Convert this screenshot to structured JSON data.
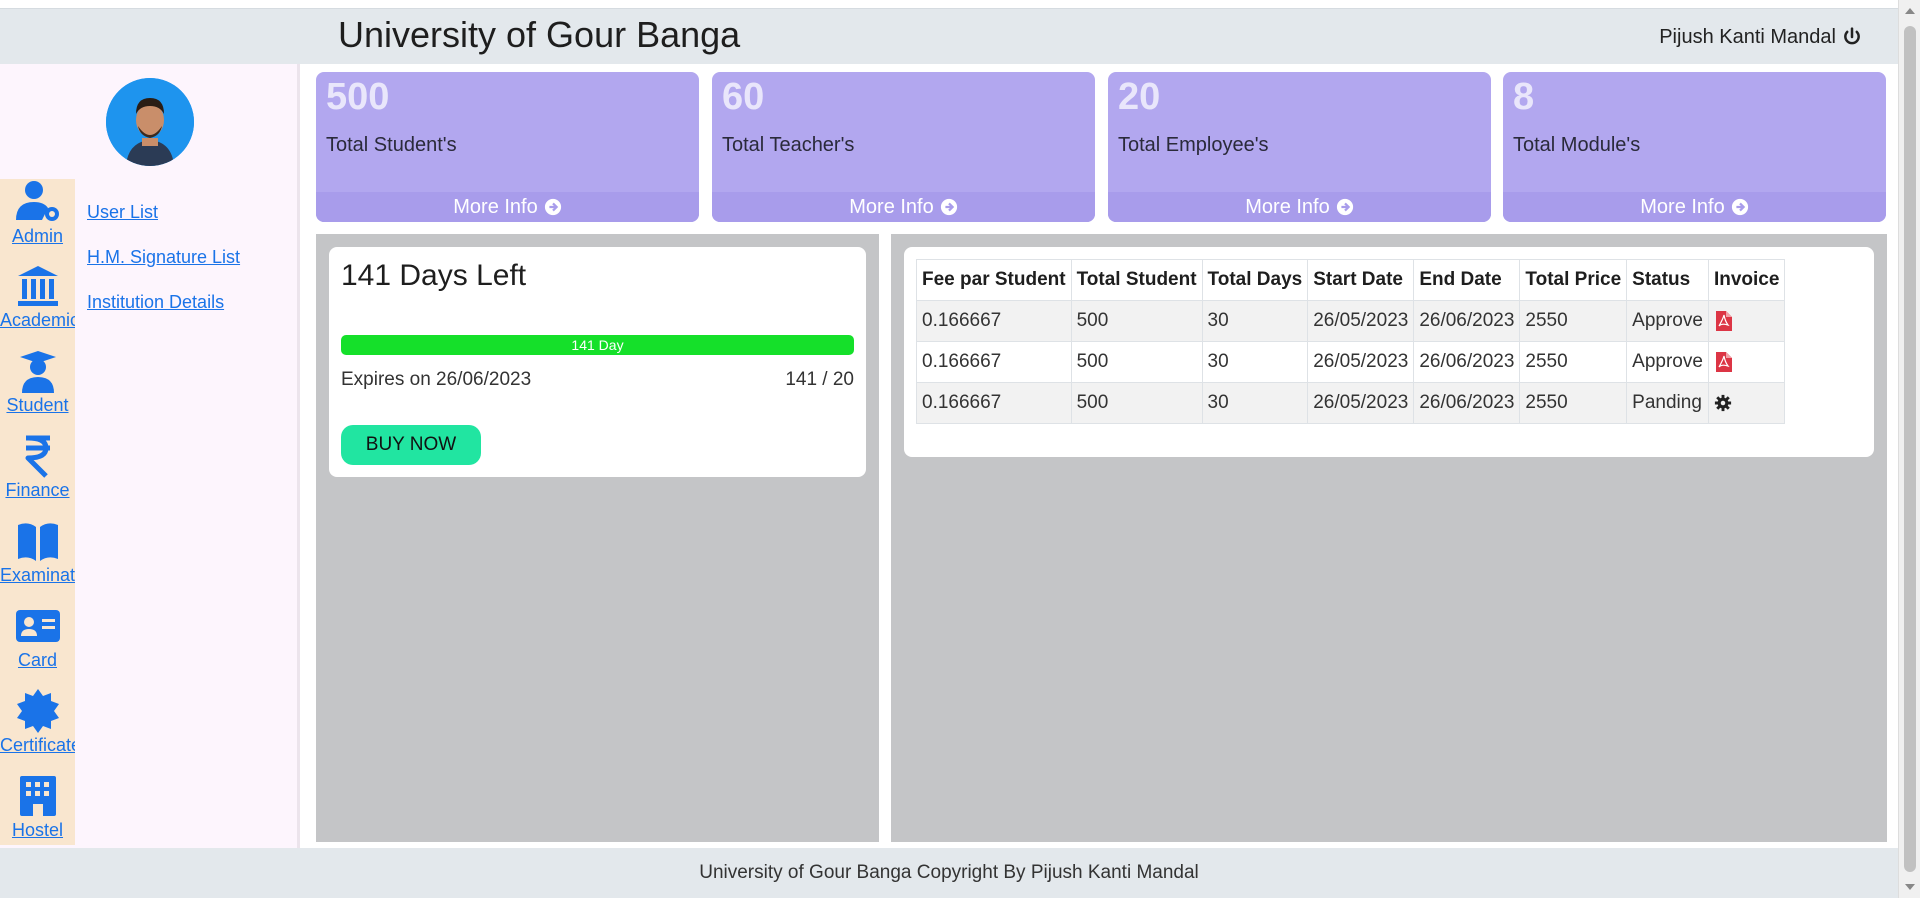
{
  "header": {
    "title": "University of Gour Banga",
    "user_name": "Pijush Kanti Mandal"
  },
  "sidebar": {
    "modules": [
      {
        "label": "Admin",
        "icon": "user-gear-icon"
      },
      {
        "label": "Academic",
        "icon": "building-columns-icon"
      },
      {
        "label": "Student",
        "icon": "graduate-icon"
      },
      {
        "label": "Finance",
        "icon": "rupee-icon"
      },
      {
        "label": "Examination",
        "icon": "book-icon"
      },
      {
        "label": "Card",
        "icon": "id-card-icon"
      },
      {
        "label": "Certificate",
        "icon": "certificate-icon"
      },
      {
        "label": "Hostel",
        "icon": "hotel-icon"
      }
    ],
    "sublinks": [
      "User List",
      "H.M. Signature List",
      "Institution Details"
    ]
  },
  "cards": [
    {
      "value": "500",
      "label": "Total Student's",
      "more": "More Info"
    },
    {
      "value": "60",
      "label": "Total Teacher's",
      "more": "More Info"
    },
    {
      "value": "20",
      "label": "Total Employee's",
      "more": "More Info"
    },
    {
      "value": "8",
      "label": "Total Module's",
      "more": "More Info"
    }
  ],
  "subscription": {
    "heading": "141 Days Left",
    "progress_label": "141 Day",
    "progress_fraction": 1.0,
    "expires": "Expires on 26/06/2023",
    "ratio": "141 / 20",
    "buy_label": "BUY NOW"
  },
  "invoices": {
    "columns": [
      "Fee par Student",
      "Total Student",
      "Total Days",
      "Start Date",
      "End Date",
      "Total Price",
      "Status",
      "Invoice"
    ],
    "rows": [
      {
        "fee": "0.166667",
        "students": "500",
        "days": "30",
        "start": "26/05/2023",
        "end": "26/06/2023",
        "price": "2550",
        "status": "Approve",
        "invoice_icon": "pdf-icon"
      },
      {
        "fee": "0.166667",
        "students": "500",
        "days": "30",
        "start": "26/05/2023",
        "end": "26/06/2023",
        "price": "2550",
        "status": "Approve",
        "invoice_icon": "pdf-icon"
      },
      {
        "fee": "0.166667",
        "students": "500",
        "days": "30",
        "start": "26/05/2023",
        "end": "26/06/2023",
        "price": "2550",
        "status": "Panding",
        "invoice_icon": "gear-icon"
      }
    ]
  },
  "footer": {
    "text": "University of Gour Banga Copyright By Pijush Kanti Mandal"
  },
  "colors": {
    "card_bg": "#b2a7ef",
    "progress": "#15e02a",
    "buy_button": "#21e5a1",
    "link": "#1a73e8"
  }
}
